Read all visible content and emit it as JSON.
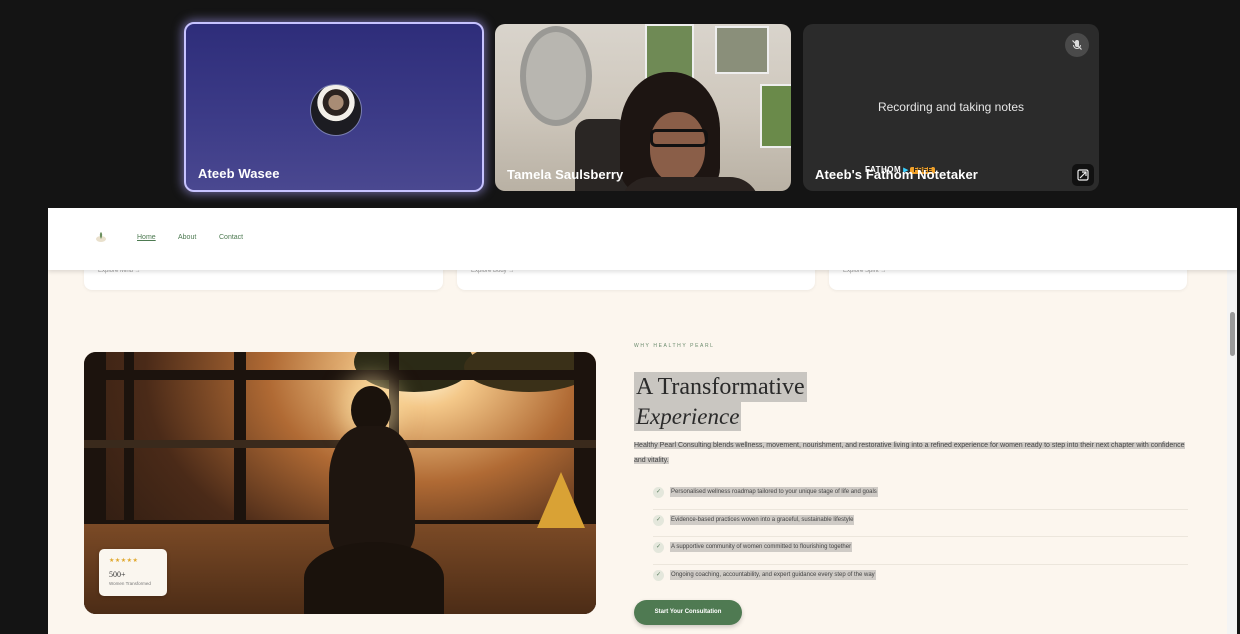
{
  "meeting": {
    "participants": [
      {
        "name": "Ateeb Wasee"
      },
      {
        "name": "Tamela Saulsberry"
      },
      {
        "name": "Ateeb's Fathom Notetaker",
        "status": "Recording and taking notes",
        "banner_logo": "FATHOM",
        "banner_badge": "FREE"
      }
    ]
  },
  "site": {
    "nav": {
      "home": "Home",
      "about": "About",
      "contact": "Contact"
    },
    "cards": [
      {
        "link": "Explore Mind →"
      },
      {
        "link": "Explore Body →"
      },
      {
        "link": "Explore Spirit →"
      }
    ],
    "stat": {
      "stars": "★★★★★",
      "number": "500+",
      "label": "Women Transformed"
    },
    "eyebrow": "WHY HEALTHY PEARL",
    "heading_line1": "A Transformative",
    "heading_line2": "Experience",
    "lead": "Healthy Pearl Consulting blends wellness, movement, nourishment, and restorative living into a refined experience for women ready to step into their next chapter with confidence and vitality.",
    "checklist": [
      "Personalised wellness roadmap tailored to your unique stage of life and goals",
      "Evidence-based practices woven into a graceful, sustainable lifestyle",
      "A supportive community of women committed to flourishing together",
      "Ongoing coaching, accountability, and expert guidance every step of the way"
    ],
    "cta": "Start Your Consultation"
  },
  "colors": {
    "accent": "#4f7a52",
    "tile_highlight": "#c7c3ff",
    "fathom_badge": "#f0a12a"
  }
}
